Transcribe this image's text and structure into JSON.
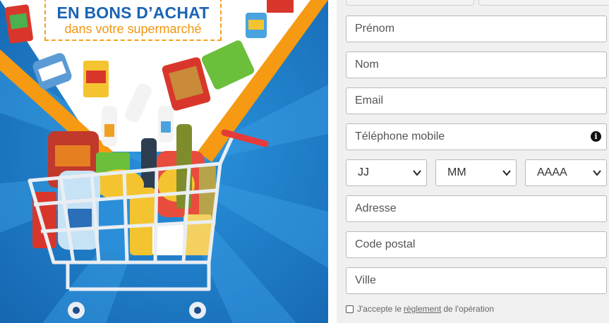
{
  "promo": {
    "title": "EN BONS D’ACHAT",
    "subtitle": "dans votre supermarché"
  },
  "form": {
    "fields": [
      {
        "placeholder": "Prénom"
      },
      {
        "placeholder": "Nom"
      },
      {
        "placeholder": "Email"
      },
      {
        "placeholder": "Téléphone mobile",
        "icon": "info-icon"
      },
      {
        "placeholder": "Adresse"
      },
      {
        "placeholder": "Code postal"
      },
      {
        "placeholder": "Ville"
      }
    ],
    "birthdate": {
      "day": "JJ",
      "month": "MM",
      "year": "AAAA"
    },
    "consent": {
      "prefix": "J'accepte le",
      "link": "règlement",
      "suffix": "de l'opération"
    },
    "info_glyph": "i"
  },
  "colors": {
    "promo_blue": "#1e7fc8",
    "accent_orange": "#f5a11a",
    "title_blue": "#1b64b3"
  }
}
